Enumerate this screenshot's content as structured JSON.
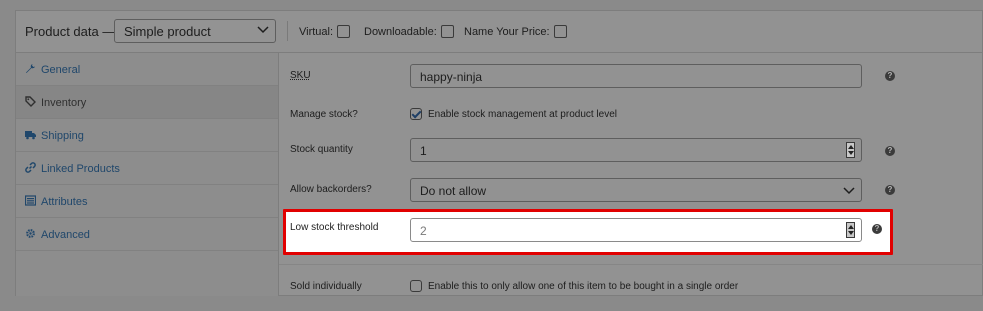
{
  "header": {
    "title": "Product data —",
    "product_type": "Simple product",
    "virtual_label": "Virtual:",
    "downloadable_label": "Downloadable:",
    "name_your_price_label": "Name Your Price:"
  },
  "sidebar": {
    "items": [
      {
        "label": "General",
        "icon": "wrench-icon"
      },
      {
        "label": "Inventory",
        "icon": "tag-icon"
      },
      {
        "label": "Shipping",
        "icon": "truck-icon"
      },
      {
        "label": "Linked Products",
        "icon": "link-icon"
      },
      {
        "label": "Attributes",
        "icon": "list-icon"
      },
      {
        "label": "Advanced",
        "icon": "gear-icon"
      }
    ]
  },
  "inventory": {
    "sku_label": "SKU",
    "sku_value": "happy-ninja",
    "manage_stock_label": "Manage stock?",
    "manage_stock_text": "Enable stock management at product level",
    "stock_quantity_label": "Stock quantity",
    "stock_quantity_value": "1",
    "backorders_label": "Allow backorders?",
    "backorders_value": "Do not allow",
    "low_stock_label": "Low stock threshold",
    "low_stock_value": "2",
    "sold_individually_label": "Sold individually",
    "sold_individually_text": "Enable this to only allow one of this item to be bought in a single order"
  },
  "help_glyph": "?",
  "colors": {
    "highlight": "#e10000",
    "link": "#20476b",
    "overlay": "#929292"
  }
}
